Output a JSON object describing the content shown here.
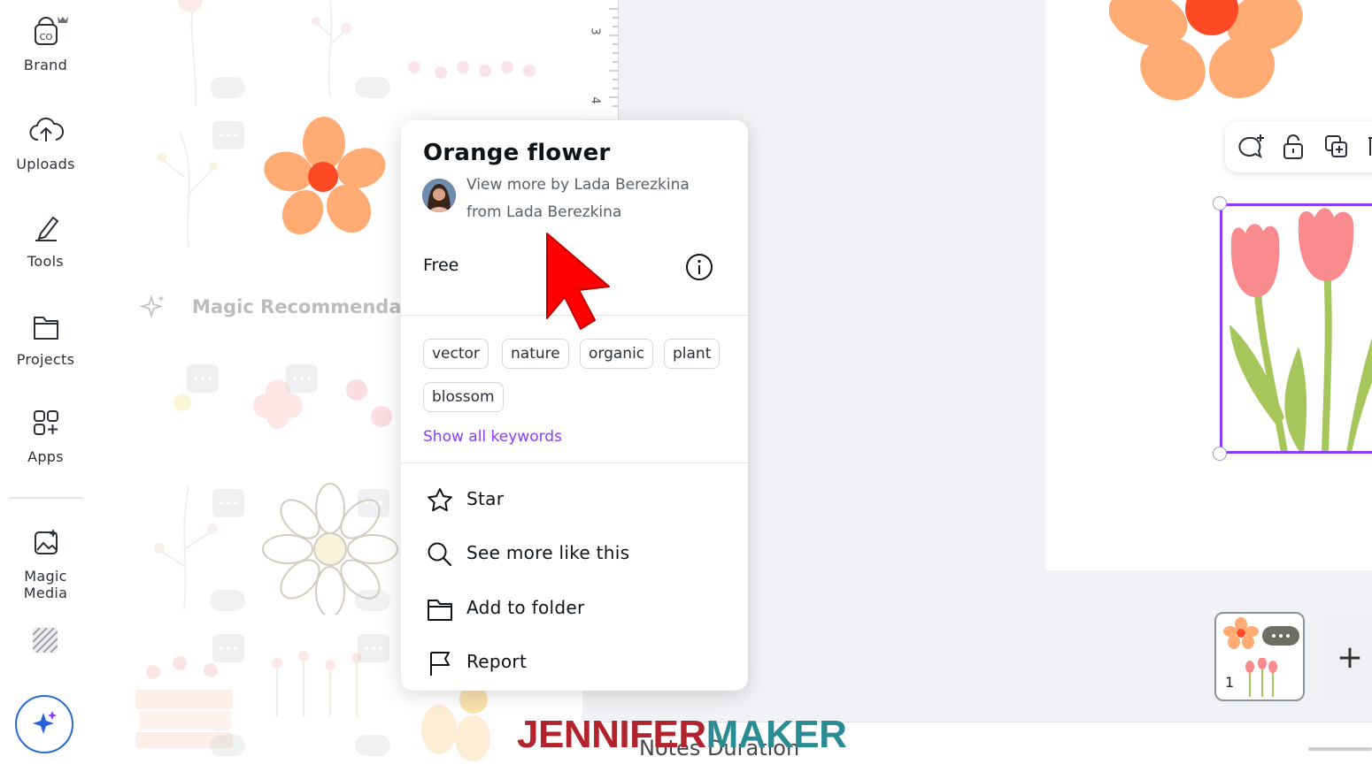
{
  "rail": {
    "items": [
      {
        "label": "Brand",
        "icon": "brand-icon"
      },
      {
        "label": "Uploads",
        "icon": "cloud-upload-icon"
      },
      {
        "label": "Tools",
        "icon": "pen-tools-icon"
      },
      {
        "label": "Projects",
        "icon": "folder-icon"
      },
      {
        "label": "Apps",
        "icon": "apps-grid-icon"
      },
      {
        "label": "Magic Media",
        "icon": "magic-media-icon"
      }
    ]
  },
  "panel": {
    "section_title": "Magic Recommendatic"
  },
  "ruler": {
    "marks": [
      "3",
      "4"
    ]
  },
  "popover": {
    "title": "Orange flower",
    "byline_line1": "View more by Lada Berezkina",
    "byline_line2": "from Lada Berezkina",
    "price": "Free",
    "tags": [
      "vector",
      "nature",
      "organic",
      "plant",
      "blossom"
    ],
    "show_keywords": "Show all keywords",
    "menu": [
      {
        "label": "Star",
        "icon": "star-icon"
      },
      {
        "label": "See more like this",
        "icon": "search-icon"
      },
      {
        "label": "Add to folder",
        "icon": "folder-icon"
      },
      {
        "label": "Report",
        "icon": "flag-icon"
      }
    ]
  },
  "pages": {
    "current": "1"
  },
  "bottom_bar": {
    "ghost_text": "Notes      Duration"
  },
  "watermark": {
    "part1": "JENNIFER",
    "part2": "MAKER"
  },
  "colors": {
    "accent": "#8b3dff",
    "flower_orange": "#ffab73",
    "flower_center": "#ff4a26",
    "tulip_pink": "#f98a8e",
    "stem_green": "#a4c65a",
    "cursor_red": "#ff0000"
  }
}
